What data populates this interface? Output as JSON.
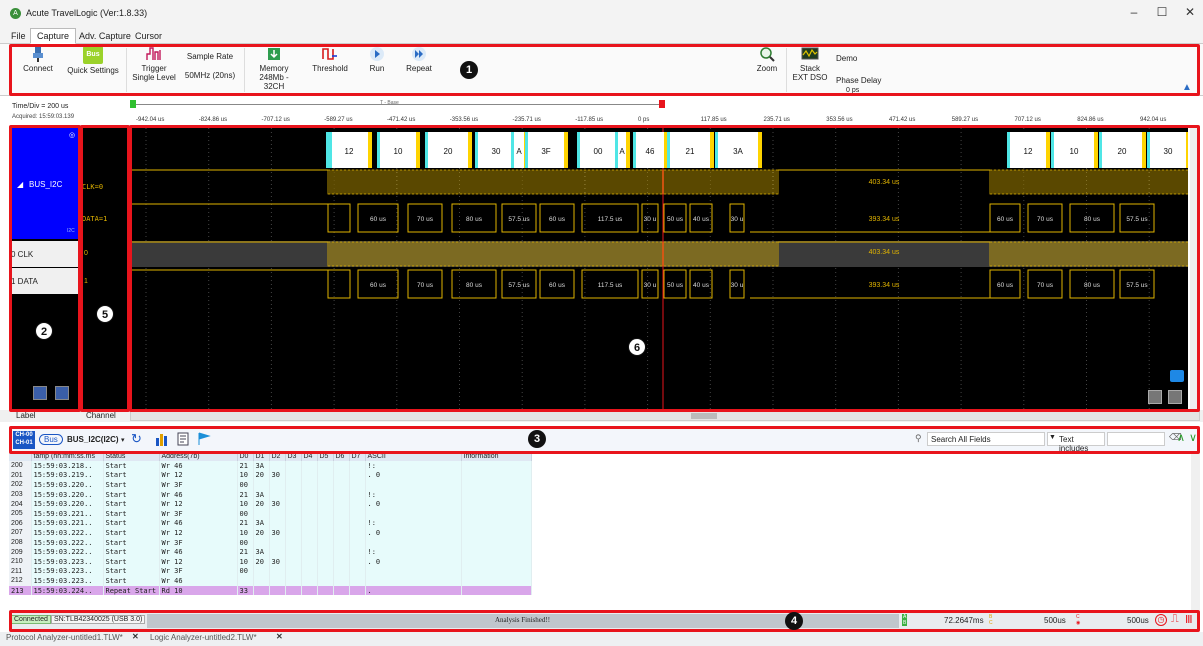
{
  "window": {
    "title": "Acute TravelLogic   (Ver:1.8.33)",
    "minimize": "–",
    "maximize": "☐",
    "close": "✕"
  },
  "menu": {
    "tabs": [
      "File",
      "Capture",
      "Adv. Capture",
      "Cursor"
    ],
    "active": "Capture"
  },
  "ribbon": {
    "connect": "Connect",
    "quick_settings": "Quick Settings",
    "quick_settings_icon_text": "Bus",
    "trigger_line1": "Trigger",
    "trigger_line2": "Single Level",
    "sample_rate_title": "Sample Rate",
    "sample_rate_value": "50MHz (20ns)",
    "memory_line1": "Memory",
    "memory_line2": "248Mb - 32CH",
    "threshold": "Threshold",
    "run": "Run",
    "repeat": "Repeat",
    "zoom": "Zoom",
    "stack_line1": "Stack",
    "stack_line2": "EXT DSO",
    "demo": "Demo",
    "phase_delay_title": "Phase Delay",
    "phase_delay_value": "0 ps"
  },
  "ruler": {
    "time_div": "Time/Div = 200 us",
    "acquired": "Acquired: 15:59:03.139",
    "ticks": [
      "-942.04 us",
      "-824.86 us",
      "-707.12 us",
      "-589.27 us",
      "-471.42 us",
      "-353.56 us",
      "-235.71 us",
      "-117.85 us",
      "0 ps",
      "117.85 us",
      "235.71 us",
      "353.56 us",
      "471.42 us",
      "589.27 us",
      "707.12 us",
      "824.86 us",
      "942.04 us"
    ],
    "delta_label": "T - Base"
  },
  "labels": {
    "bus": "BUS_I2C",
    "bus_sub": "I2C",
    "ch0": "0 CLK",
    "ch1": "1 DATA",
    "bus_clk": "CLK=0",
    "bus_data": "DATA=1",
    "ch0_num": "0",
    "ch1_num": "1"
  },
  "waveform": {
    "packets": [
      "12",
      "10",
      "20",
      "30",
      "A",
      "3F",
      "00",
      "A",
      "46",
      "21",
      "3A",
      "12",
      "10",
      "20",
      "30"
    ],
    "clk_gap": "403.34 us",
    "data_gap": "393.34 us",
    "durations": [
      "60 us",
      "70 us",
      "80 us",
      "57.5 us",
      "60 us",
      "117.5 us",
      "30 u",
      "50 us",
      "40 us",
      "30 u",
      "60 us",
      "70 us",
      "80 us",
      "57.5 us"
    ]
  },
  "label_row": {
    "label": "Label",
    "channel": "Channel"
  },
  "protocol_toolbar": {
    "ch_badge_top": "CH-00",
    "ch_badge_bottom": "CH-01",
    "bus_chip": "Bus",
    "bus_name": "BUS_I2C(I2C)",
    "search_placeholder": "Search All Fields",
    "filter_mode": "Text includes"
  },
  "table": {
    "columns": [
      "",
      "tamp (hh:mm:ss.ms",
      "Status",
      "Address(7b)",
      "D0",
      "D1",
      "D2",
      "D3",
      "D4",
      "D5",
      "D6",
      "D7",
      "ASCII",
      "Information"
    ],
    "rows": [
      [
        "200",
        "15:59:03.218..",
        "Start",
        "Wr 46",
        "21",
        "3A",
        "",
        "",
        "",
        "",
        "",
        "",
        "!:",
        ""
      ],
      [
        "201",
        "15:59:03.219..",
        "Start",
        "Wr 12",
        "10",
        "20",
        "30",
        "",
        "",
        "",
        "",
        "",
        ". 0",
        ""
      ],
      [
        "202",
        "15:59:03.220..",
        "Start",
        "Wr 3F",
        "00",
        "",
        "",
        "",
        "",
        "",
        "",
        "",
        "",
        ""
      ],
      [
        "203",
        "15:59:03.220..",
        "Start",
        "Wr 46",
        "21",
        "3A",
        "",
        "",
        "",
        "",
        "",
        "",
        "!:",
        ""
      ],
      [
        "204",
        "15:59:03.220..",
        "Start",
        "Wr 12",
        "10",
        "20",
        "30",
        "",
        "",
        "",
        "",
        "",
        ". 0",
        ""
      ],
      [
        "205",
        "15:59:03.221..",
        "Start",
        "Wr 3F",
        "00",
        "",
        "",
        "",
        "",
        "",
        "",
        "",
        "",
        ""
      ],
      [
        "206",
        "15:59:03.221..",
        "Start",
        "Wr 46",
        "21",
        "3A",
        "",
        "",
        "",
        "",
        "",
        "",
        "!:",
        ""
      ],
      [
        "207",
        "15:59:03.222..",
        "Start",
        "Wr 12",
        "10",
        "20",
        "30",
        "",
        "",
        "",
        "",
        "",
        ". 0",
        ""
      ],
      [
        "208",
        "15:59:03.222..",
        "Start",
        "Wr 3F",
        "00",
        "",
        "",
        "",
        "",
        "",
        "",
        "",
        "",
        ""
      ],
      [
        "209",
        "15:59:03.222..",
        "Start",
        "Wr 46",
        "21",
        "3A",
        "",
        "",
        "",
        "",
        "",
        "",
        "!:",
        ""
      ],
      [
        "210",
        "15:59:03.223..",
        "Start",
        "Wr 12",
        "10",
        "20",
        "30",
        "",
        "",
        "",
        "",
        "",
        ". 0",
        ""
      ],
      [
        "211",
        "15:59:03.223..",
        "Start",
        "Wr 3F",
        "00",
        "",
        "",
        "",
        "",
        "",
        "",
        "",
        "",
        ""
      ],
      [
        "212",
        "15:59:03.223..",
        "Start",
        "Wr 46",
        "",
        "",
        "",
        "",
        "",
        "",
        "",
        "",
        "",
        ""
      ],
      [
        "213",
        "15:59:03.224..",
        "Repeat Start",
        "Rd 10",
        "33",
        "",
        "",
        "",
        "",
        "",
        "",
        "",
        ".",
        ""
      ]
    ]
  },
  "status": {
    "connected": "Connected",
    "serial": "SN:TLB42340025 (USB 3.0)",
    "message": "Analysis Finished!!",
    "time_ab": "72.2647ms",
    "time_bc": "500us",
    "time_c": "500us"
  },
  "bottom_tabs": [
    "Protocol Analyzer-untitled1.TLW*",
    "Logic Analyzer-untitled2.TLW*"
  ],
  "callouts": [
    "1",
    "2",
    "3",
    "4",
    "5",
    "6"
  ],
  "colors": {
    "highlight_red": "#e8141c",
    "bus_blue": "#0000ff",
    "wave_yellow": "#e0b300",
    "packet_cyan": "#4fe6e6"
  }
}
